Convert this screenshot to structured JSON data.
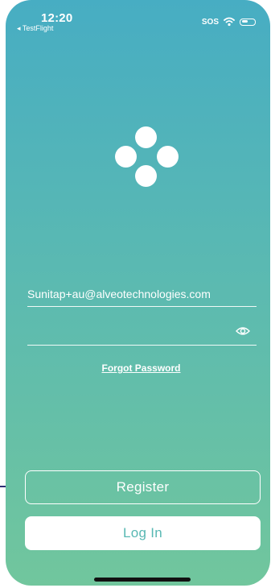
{
  "status_bar": {
    "time": "12:20",
    "back_label": "◂ TestFlight",
    "sos": "SOS",
    "icons": [
      "wifi-icon",
      "battery-icon"
    ]
  },
  "logo": {
    "icon": "four-circles-logo"
  },
  "form": {
    "email_value": "Sunitap+au@alveotechnologies.com",
    "password_value": "",
    "password_toggle_icon": "eye-icon",
    "forgot_password": "Forgot Password"
  },
  "actions": {
    "register_label": "Register",
    "login_label": "Log In"
  },
  "colors": {
    "gradient_top": "#47adc3",
    "gradient_bottom": "#71c69d",
    "login_text": "#58b8b3",
    "accent_line": "#2f2e74"
  }
}
